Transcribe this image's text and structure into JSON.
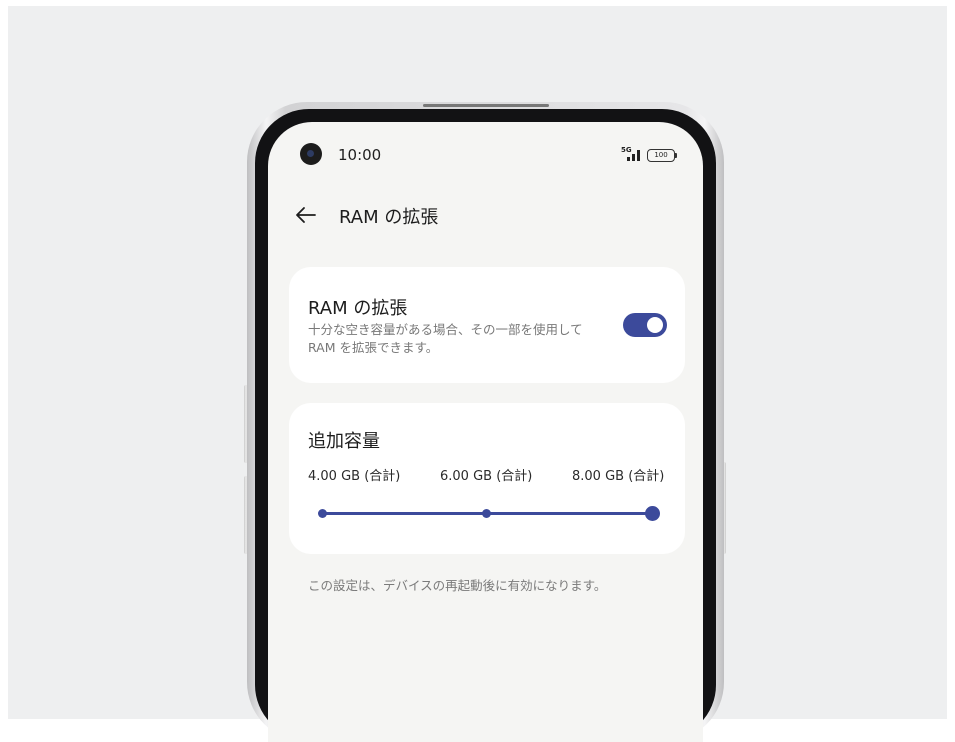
{
  "status_bar": {
    "time": "10:00",
    "network": "5G",
    "battery": "100"
  },
  "header": {
    "title": "RAM の拡張",
    "back_icon": "arrow-left-icon"
  },
  "ram_toggle": {
    "title": "RAM の拡張",
    "description": "十分な空き容量がある場合、その一部を使用して RAM を拡張できます。",
    "enabled": true
  },
  "capacity": {
    "title": "追加容量",
    "options": [
      "4.00 GB (合計)",
      "6.00 GB (合計)",
      "8.00 GB (合計)"
    ],
    "selected": "8.00 GB (合計)"
  },
  "footnote": "この設定は、デバイスの再起動後に有効になります。",
  "colors": {
    "accent": "#3c4a9b",
    "background": "#eeeff0",
    "screen": "#f5f5f3",
    "card": "#ffffff"
  }
}
